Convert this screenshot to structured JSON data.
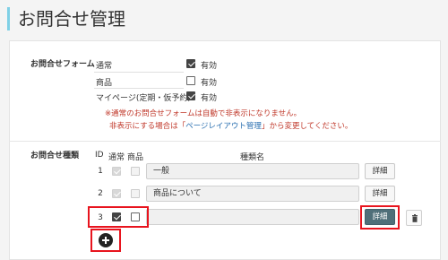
{
  "page": {
    "title": "お問合せ管理"
  },
  "forms_section": {
    "label": "お問合せフォーム",
    "rows": [
      {
        "name": "通常",
        "valid_label": "有効",
        "checked": true
      },
      {
        "name": "商品",
        "valid_label": "有効",
        "checked": false
      },
      {
        "name": "マイページ(定期・仮予約)",
        "valid_label": "有効",
        "checked": true
      }
    ],
    "note_line1": "※通常のお問合せフォームは自動で非表示になりません。",
    "note_line2_prefix": "非表示にする場合は「",
    "note_link": "ページレイアウト管理",
    "note_line2_suffix": "」から変更してください。"
  },
  "types_section": {
    "label": "お問合せ種類",
    "headers": {
      "id": "ID",
      "normal": "通常",
      "product": "商品",
      "name": "種類名"
    },
    "rows": [
      {
        "id": "1",
        "normal": true,
        "product": false,
        "name": "一般",
        "detail": "詳細"
      },
      {
        "id": "2",
        "normal": true,
        "product": false,
        "name": "商品について",
        "detail": "詳細"
      },
      {
        "id": "3",
        "normal": true,
        "product": false,
        "name": "",
        "detail": "詳細"
      }
    ]
  },
  "icons": {
    "trash": "trash-icon",
    "add": "plus-circle-icon"
  },
  "colors": {
    "accent": "#7fd0e6",
    "highlight": "#e8141e",
    "primary_button": "#4f6f79",
    "note_text": "#c0392b",
    "link": "#2a6fb0"
  }
}
